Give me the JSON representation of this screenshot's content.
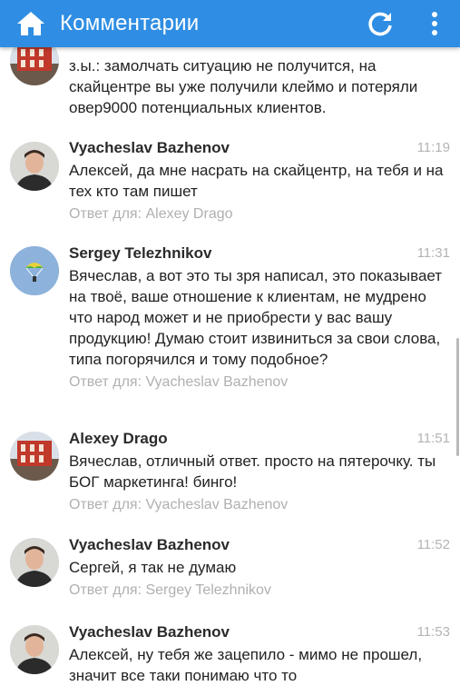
{
  "app": {
    "title": "Комментарии",
    "accent": "#2f8ee3",
    "icons": [
      "home-icon",
      "refresh-icon",
      "more-vert-icon"
    ]
  },
  "comments": [
    {
      "author": "",
      "time": "",
      "text": "з.ы.: замолчать ситуацию не получится, на скайцентре вы уже получили клеймо и потеряли овер9000 потенциальных клиентов.",
      "reply": "",
      "avatar": "building-avatar"
    },
    {
      "author": "Vyacheslav Bazhenov",
      "time": "11:19",
      "text": "Алексей, да мне насрать на скайцентр, на тебя и на тех кто там пишет",
      "reply": "Ответ для: Alexey Drago",
      "avatar": "man-avatar"
    },
    {
      "author": "Sergey Telezhnikov",
      "time": "11:31",
      "text": "Вячеслав, а вот это ты зря написал, это показывает на твоё, ваше отношение к клиентам, не мудрено что народ может и не приобрести у вас вашу продукцию! Думаю стоит извиниться за свои слова, типа погорячился и тому подобное?",
      "reply": "Ответ для: Vyacheslav Bazhenov",
      "avatar": "parachute-avatar"
    },
    {
      "author": "Alexey Drago",
      "time": "11:51",
      "text": "Вячеслав, отличный ответ. просто на пятерочку. ты БОГ маркетинга! бинго!",
      "reply": "Ответ для: Vyacheslav Bazhenov",
      "avatar": "building-avatar"
    },
    {
      "author": "Vyacheslav Bazhenov",
      "time": "11:52",
      "text": "Сергей, я так не думаю",
      "reply": "Ответ для: Sergey Telezhnikov",
      "avatar": "man-avatar"
    },
    {
      "author": "Vyacheslav Bazhenov",
      "time": "11:53",
      "text": "Алексей, ну тебя же зацепило - мимо не прошел, значит все таки понимаю что то",
      "reply": "",
      "avatar": "man-avatar"
    }
  ]
}
